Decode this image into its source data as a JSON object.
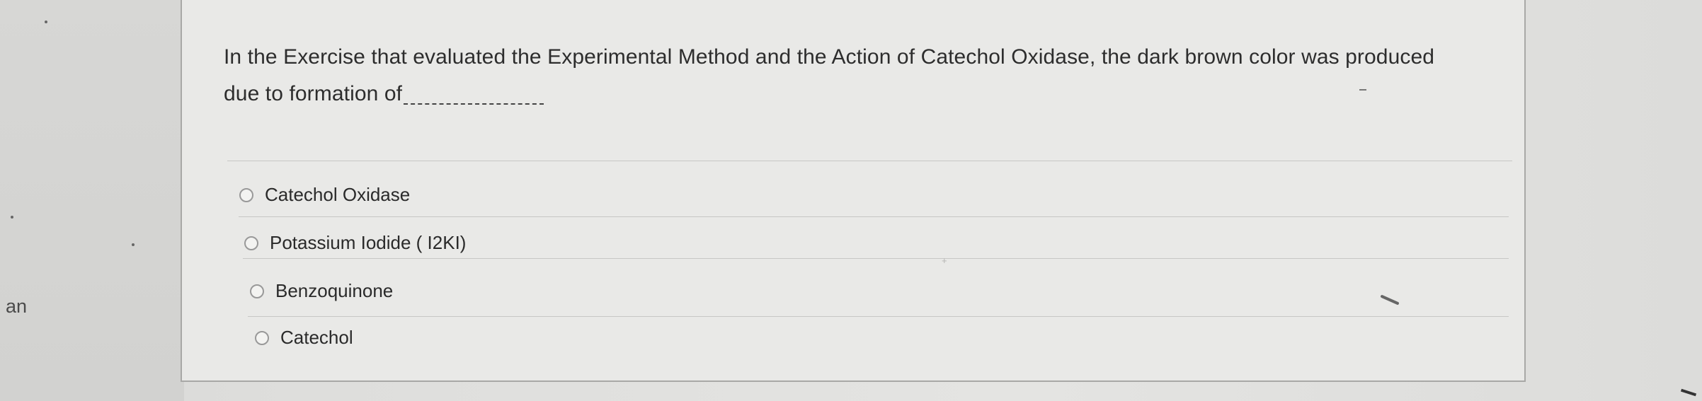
{
  "page": {
    "background_color": "#dededc",
    "card_color": "#e9e9e7",
    "text_color": "#2d2d2d",
    "cut_off_text": "an"
  },
  "question": {
    "text": "In the Exercise that evaluated the Experimental Method and the Action of Catechol Oxidase, the dark brown color was produced due to formation of",
    "blank": "_____________"
  },
  "options": [
    {
      "label": "Catechol Oxidase",
      "selected": false
    },
    {
      "label": "Potassium Iodide ( I2KI)",
      "selected": false
    },
    {
      "label": "Benzoquinone",
      "selected": false
    },
    {
      "label": "Catechol",
      "selected": false
    }
  ]
}
